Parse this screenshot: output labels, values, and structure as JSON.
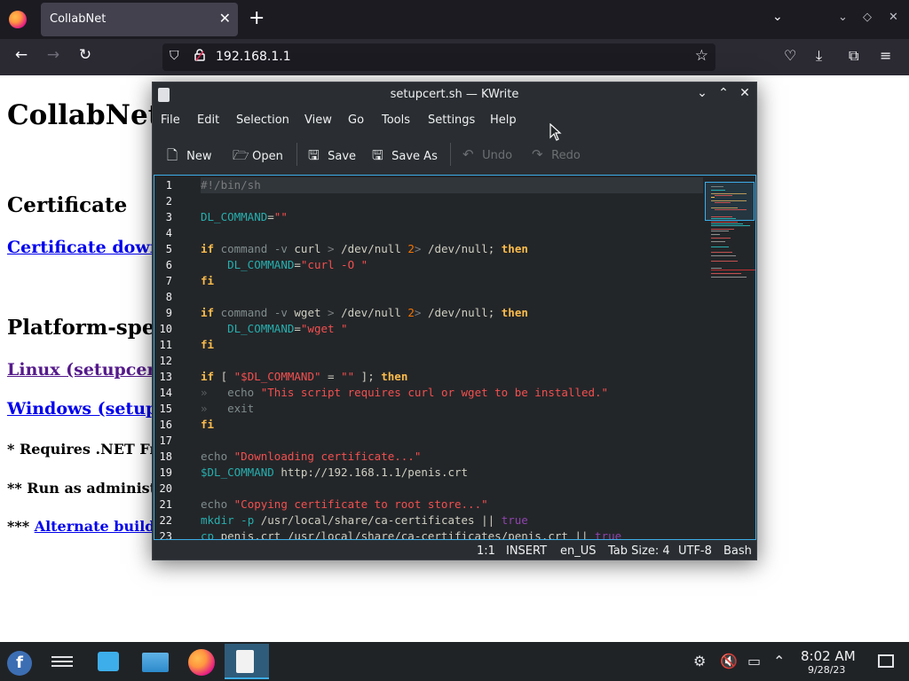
{
  "browser": {
    "tab_title": "CollabNet",
    "tab_close": "✕",
    "new_tab": "+",
    "url": "192.168.1.1"
  },
  "webpage": {
    "title": "CollabNet",
    "certificate_heading": "Certificate",
    "certificate_link": "Certificate downl",
    "platform_heading": "Platform-spec",
    "linux_link": "Linux (setupcert.",
    "windows_link": "Windows (setupc",
    "note_net": "* Requires .NET Fran",
    "note_admin": "** Run as administra",
    "note_alt_prefix": "*** ",
    "note_alt_link": "Alternate build f"
  },
  "kwrite": {
    "title": "setupcert.sh — KWrite",
    "menu": [
      "File",
      "Edit",
      "Selection",
      "View",
      "Go",
      "Tools",
      "Settings",
      "Help"
    ],
    "toolbar": {
      "new": "New",
      "open": "Open",
      "save": "Save",
      "save_as": "Save As",
      "undo": "Undo",
      "redo": "Redo"
    },
    "line_numbers": [
      "1",
      "2",
      "3",
      "4",
      "5",
      "6",
      "7",
      "8",
      "9",
      "10",
      "11",
      "12",
      "13",
      "14",
      "15",
      "16",
      "17",
      "18",
      "19",
      "20",
      "21",
      "22",
      "23"
    ],
    "code": {
      "l1": "#!/bin/sh",
      "l3_var": "DL_COMMAND",
      "l3_eq": "=",
      "l3_str": "\"\"",
      "kw_if": "if",
      "kw_then": "then",
      "kw_fi": "fi",
      "bi_command": "command",
      "opt_v": "-v",
      "curl": "curl",
      "wget": "wget",
      "gt": ">",
      "devnull": "/dev/null",
      "two": "2",
      "semi": ";",
      "l6_str": "\"curl -O \"",
      "l10_str": "\"wget \"",
      "l13_lb": "[",
      "l13_var": "\"$DL_COMMAND\"",
      "l13_mid": " = ",
      "l13_empty": "\"\"",
      "l13_rb": " ];",
      "tabmark": "»",
      "echo": "echo",
      "l14_str": "\"This script requires curl or wget to be installed.\"",
      "exit": "exit",
      "l18_str": "\"Downloading certificate...\"",
      "l19_var": "$DL_COMMAND",
      "l19_url": " http://192.168.1.1/penis.crt",
      "l21_str": "\"Copying certificate to root store...\"",
      "mkdir": "mkdir",
      "opt_p": "-p",
      "l22_path": " /usr/local/share/ca-certificates || ",
      "true": "true",
      "cp": "cp",
      "l23_rest": " penis.crt /usr/local/share/ca-certificates/penis.crt || "
    },
    "status": {
      "position": "1:1",
      "mode": "INSERT",
      "language": "en_US",
      "tab_size": "Tab Size: 4",
      "encoding": "UTF-8",
      "syntax": "Bash"
    }
  },
  "taskbar": {
    "clock_time": "8:02 AM",
    "clock_date": "9/28/23",
    "fedora_glyph": "f"
  },
  "icons": {
    "back": "←",
    "forward": "→",
    "reload": "↻",
    "shield": "⛉",
    "lock": "🔒",
    "star": "☆",
    "pocket": "♡",
    "download": "⤓",
    "extensions": "⧉",
    "menu": "≡",
    "chevron": "⌄",
    "min": "⌄",
    "max": "◇",
    "close": "✕",
    "k_min": "⌄",
    "k_max": "⌃",
    "k_close": "✕",
    "new": "🗋",
    "open": "🗁",
    "save": "🖫",
    "save_as": "🖫",
    "undo": "↶",
    "redo": "↷",
    "tray_net": "⚙",
    "tray_mute": "🔇",
    "tray_display": "▭",
    "tray_up": "⌃",
    "cursor": "➤"
  },
  "colors": {
    "accent": "#3daee9",
    "ff_dark": "#1c1b22",
    "kwrite_bg": "#2a2e32",
    "editor_bg": "#232629"
  }
}
